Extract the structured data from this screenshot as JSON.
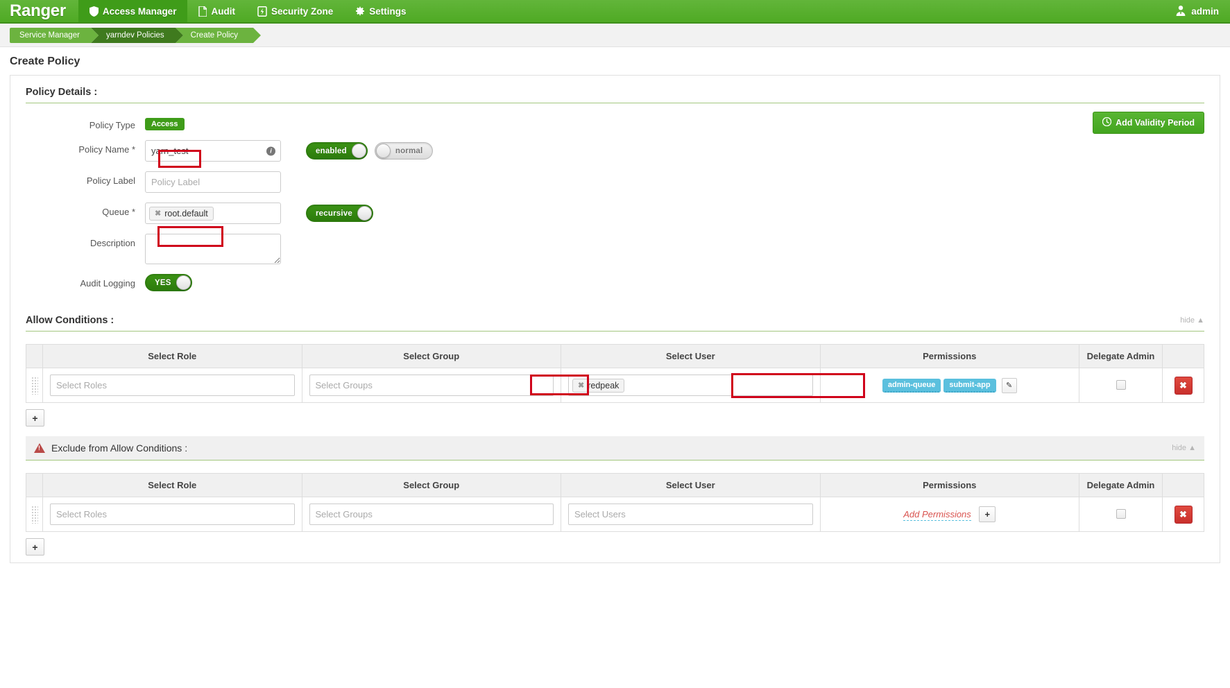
{
  "nav": {
    "brand": "Ranger",
    "items": [
      {
        "label": "Access Manager",
        "icon": "shield-icon",
        "active": true
      },
      {
        "label": "Audit",
        "icon": "file-icon",
        "active": false
      },
      {
        "label": "Security Zone",
        "icon": "bolt-icon",
        "active": false
      },
      {
        "label": "Settings",
        "icon": "gear-icon",
        "active": false
      }
    ],
    "user": "admin",
    "user_icon": "user-avatar-icon"
  },
  "breadcrumb": {
    "items": [
      "Service Manager",
      "yarndev Policies",
      "Create Policy"
    ]
  },
  "page": {
    "title": "Create Policy"
  },
  "policy_details": {
    "heading": "Policy Details :",
    "validity_button": "Add Validity Period",
    "validity_icon": "clock-icon",
    "policy_type_label": "Policy Type",
    "policy_type_value": "Access",
    "policy_name_label": "Policy Name *",
    "policy_name_value": "yarn_test",
    "policy_name_info_icon": "info-icon",
    "enabled_toggle": "enabled",
    "normal_toggle": "normal",
    "policy_label_label": "Policy Label",
    "policy_label_value": "",
    "policy_label_placeholder": "Policy Label",
    "queue_label": "Queue *",
    "queue_token": "root.default",
    "recursive_toggle": "recursive",
    "description_label": "Description",
    "description_value": "",
    "audit_logging_label": "Audit Logging",
    "audit_logging_toggle": "YES"
  },
  "allow_conditions": {
    "heading": "Allow Conditions :",
    "hide_link": "hide",
    "columns": [
      "Select Role",
      "Select Group",
      "Select User",
      "Permissions",
      "Delegate Admin"
    ],
    "row": {
      "role_placeholder": "Select Roles",
      "role_value": "",
      "group_placeholder": "Select Groups",
      "group_value": "",
      "user_token": "redpeak",
      "permissions": [
        "admin-queue",
        "submit-app"
      ],
      "edit_icon": "pencil-icon",
      "delegate_admin_checked": false,
      "delete_icon": "close-icon"
    },
    "add_row_icon": "plus-icon"
  },
  "exclude_conditions": {
    "heading": "Exclude from Allow Conditions :",
    "warning_icon": "warning-triangle-icon",
    "hide_link": "hide",
    "columns": [
      "Select Role",
      "Select Group",
      "Select User",
      "Permissions",
      "Delegate Admin"
    ],
    "row": {
      "role_placeholder": "Select Roles",
      "role_value": "",
      "group_placeholder": "Select Groups",
      "group_value": "",
      "user_placeholder": "Select Users",
      "user_value": "",
      "add_permissions_label": "Add Permissions",
      "add_permissions_icon": "plus-icon",
      "delegate_admin_checked": false,
      "delete_icon": "close-icon"
    },
    "add_row_icon": "plus-icon"
  },
  "colors": {
    "brand_green": "#4faa24",
    "accent_green": "#6cb33f",
    "dark_green": "#3f7a1e",
    "badge_teal": "#5bc0de",
    "danger_red": "#c9302c",
    "annotation_red": "#d0021b"
  }
}
